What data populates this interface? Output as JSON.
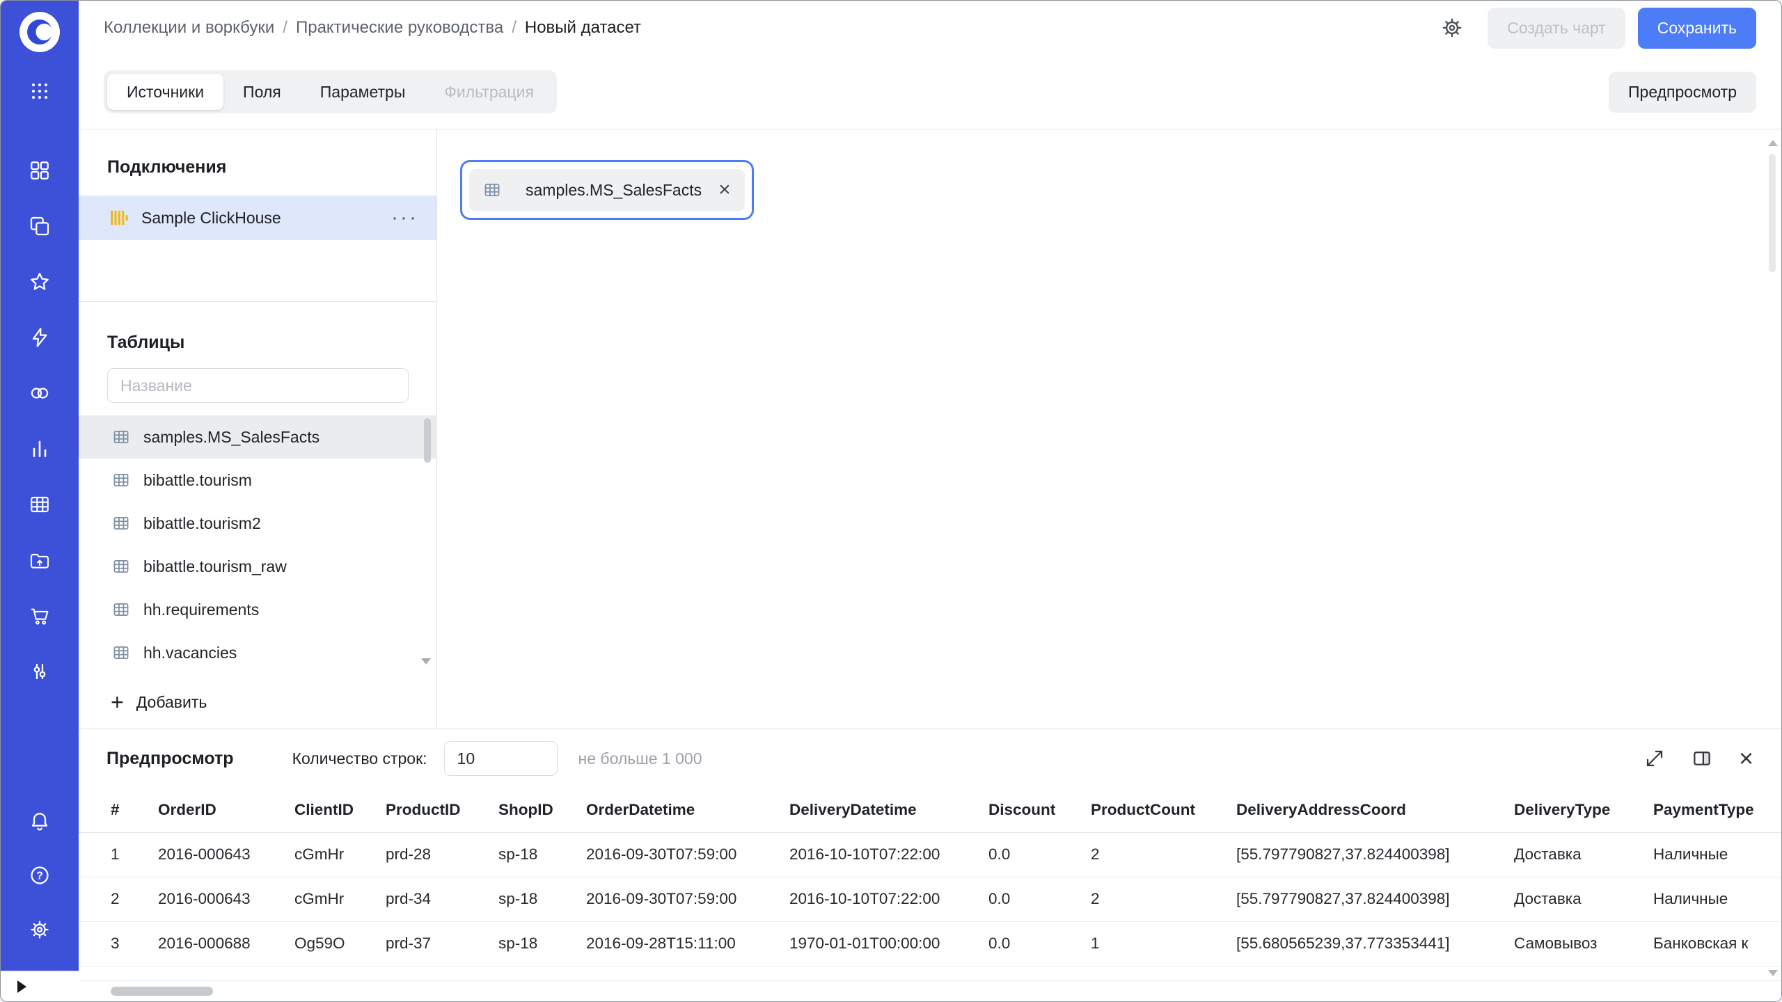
{
  "window": {
    "breadcrumb": {
      "items": [
        "Коллекции и воркбуки",
        "Практические руководства",
        "Новый датасет"
      ],
      "separator": "/"
    },
    "actions": {
      "create_chart": "Создать чарт",
      "save": "Сохранить"
    }
  },
  "tabs": {
    "sources": "Источники",
    "fields": "Поля",
    "parameters": "Параметры",
    "filtering": "Фильтрация",
    "preview_button": "Предпросмотр"
  },
  "connections_panel": {
    "title": "Подключения",
    "connection_name": "Sample ClickHouse"
  },
  "tables_panel": {
    "title": "Таблицы",
    "search_placeholder": "Название",
    "items": [
      "samples.MS_SalesFacts",
      "bibattle.tourism",
      "bibattle.tourism2",
      "bibattle.tourism_raw",
      "hh.requirements",
      "hh.vacancies"
    ],
    "selected_index": 0,
    "add_label": "Добавить"
  },
  "canvas": {
    "selected_table": "samples.MS_SalesFacts"
  },
  "preview": {
    "title": "Предпросмотр",
    "rows_label": "Количество строк:",
    "rows_value": "10",
    "rows_hint": "не больше 1 000",
    "table": {
      "columns": [
        "#",
        "OrderID",
        "ClientID",
        "ProductID",
        "ShopID",
        "OrderDatetime",
        "DeliveryDatetime",
        "Discount",
        "ProductCount",
        "DeliveryAddressCoord",
        "DeliveryType",
        "PaymentType"
      ],
      "rows": [
        [
          "1",
          "2016-000643",
          "cGmHr",
          "prd-28",
          "sp-18",
          "2016-09-30T07:59:00",
          "2016-10-10T07:22:00",
          "0.0",
          "2",
          "[55.797790827,37.824400398]",
          "Доставка",
          "Наличные"
        ],
        [
          "2",
          "2016-000643",
          "cGmHr",
          "prd-34",
          "sp-18",
          "2016-09-30T07:59:00",
          "2016-10-10T07:22:00",
          "0.0",
          "2",
          "[55.797790827,37.824400398]",
          "Доставка",
          "Наличные"
        ],
        [
          "3",
          "2016-000688",
          "Og59O",
          "prd-37",
          "sp-18",
          "2016-09-28T15:11:00",
          "1970-01-01T00:00:00",
          "0.0",
          "1",
          "[55.680565239,37.773353441]",
          "Самовывоз",
          "Банковская к"
        ]
      ]
    }
  },
  "icons": {
    "ellipsis": "···",
    "plus": "+",
    "close": "×",
    "sidebar_icon_names": [
      "datalens-logo",
      "apps-grid",
      "tiles",
      "collections",
      "star",
      "lightning",
      "circles",
      "bar-chart",
      "table-grid",
      "folder-upload",
      "cart",
      "sliders",
      "bell",
      "help",
      "gear"
    ]
  },
  "colors": {
    "accent_blue": "#4C7DF7",
    "sidebar_blue": "#3C50D8",
    "connection_selected_bg": "#DFE7FB",
    "table_selected_bg": "#EBECED",
    "clickhouse_yellow": "#F1B812"
  }
}
